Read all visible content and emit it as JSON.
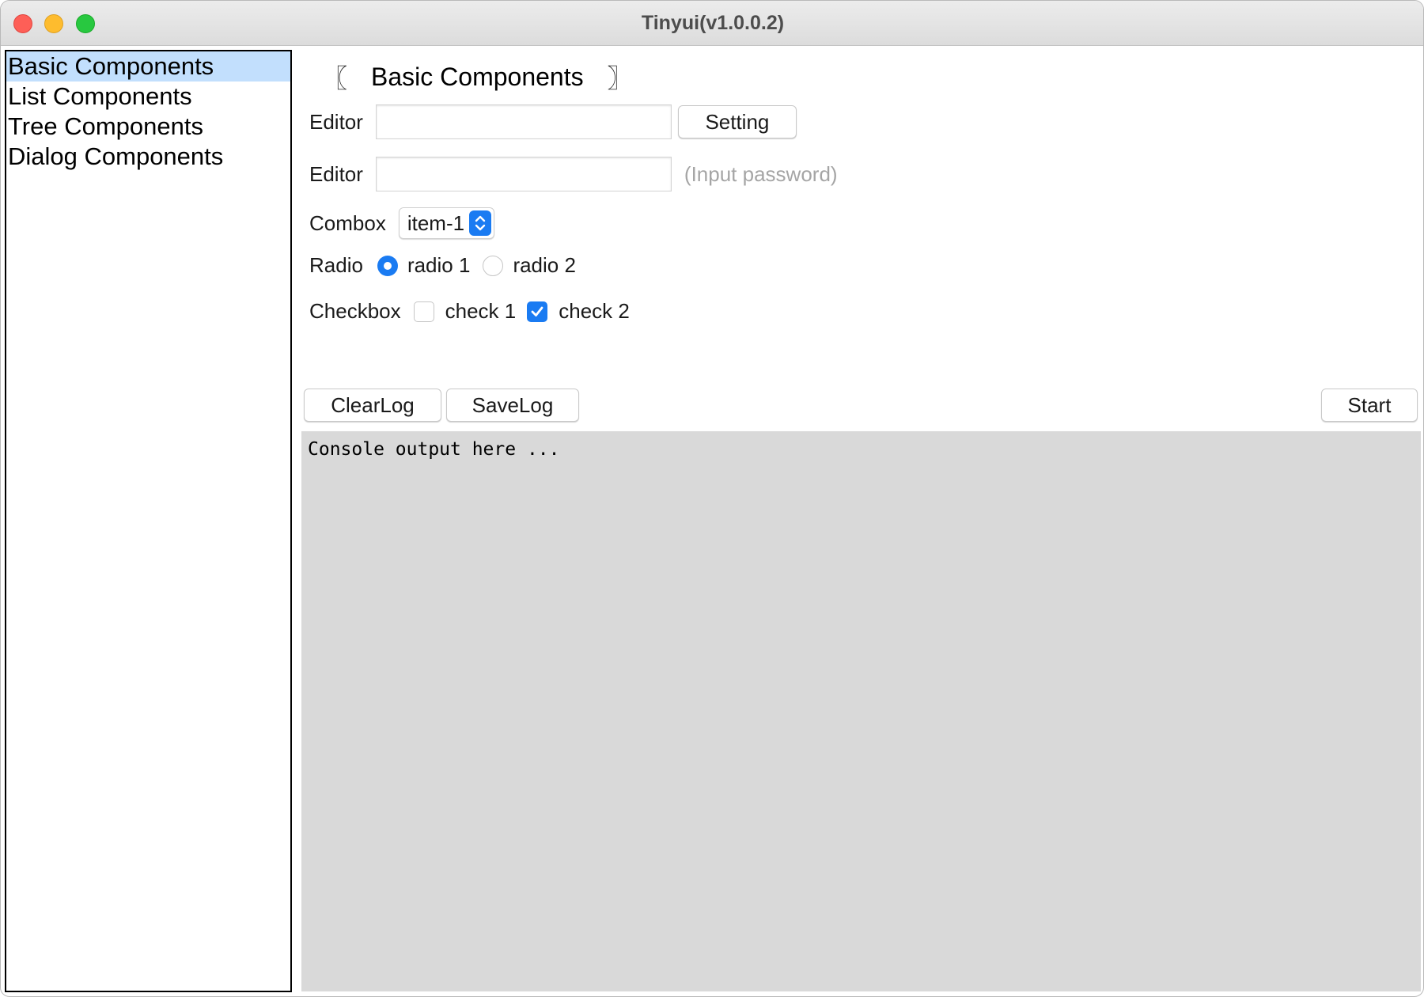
{
  "window": {
    "title": "Tinyui(v1.0.0.2)"
  },
  "sidebar": {
    "items": [
      {
        "label": "Basic Components",
        "selected": true
      },
      {
        "label": "List Components",
        "selected": false
      },
      {
        "label": "Tree Components",
        "selected": false
      },
      {
        "label": "Dialog Components",
        "selected": false
      }
    ]
  },
  "section": {
    "bracket_left": "〖",
    "title": "Basic Components",
    "bracket_right": "〗"
  },
  "form": {
    "editor1": {
      "label": "Editor",
      "value": "",
      "button_label": "Setting"
    },
    "editor2": {
      "label": "Editor",
      "value": "",
      "hint": "(Input password)"
    },
    "combo": {
      "label": "Combox",
      "selected": "item-1"
    },
    "radio": {
      "label": "Radio",
      "options": [
        {
          "label": "radio 1",
          "checked": true
        },
        {
          "label": "radio 2",
          "checked": false
        }
      ]
    },
    "checkbox": {
      "label": "Checkbox",
      "options": [
        {
          "label": "check 1",
          "checked": false
        },
        {
          "label": "check 2",
          "checked": true
        }
      ]
    }
  },
  "log_toolbar": {
    "clear_label": "ClearLog",
    "save_label": "SaveLog",
    "start_label": "Start"
  },
  "console": {
    "text": "Console output here ..."
  },
  "colors": {
    "accent": "#1a7bf2",
    "selection": "#c2dffd",
    "console_bg": "#d9d9d9"
  }
}
